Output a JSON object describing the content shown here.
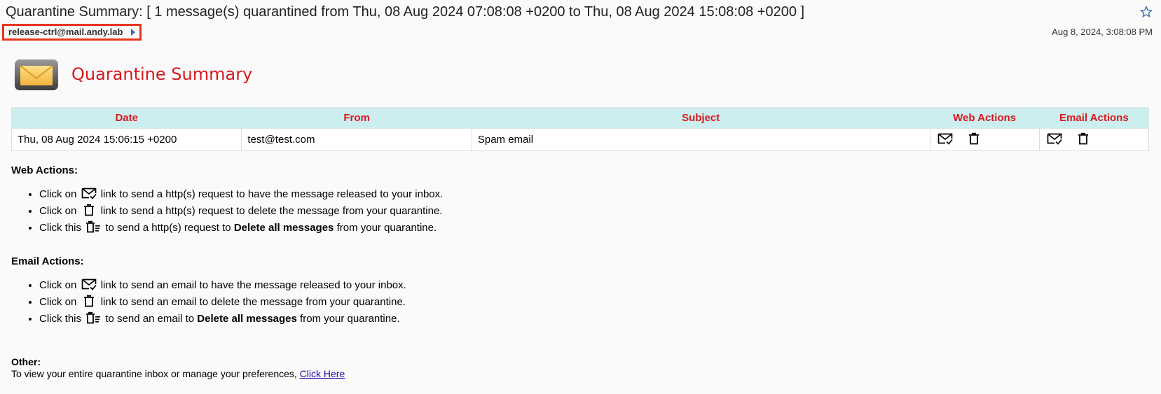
{
  "header": {
    "subject": "Quarantine Summary: [ 1 message(s) quarantined from Thu, 08 Aug 2024 07:08:08 +0200 to Thu, 08 Aug 2024 15:08:08 +0200 ]",
    "sender": "release-ctrl@mail.andy.lab",
    "date": "Aug 8, 2024, 3:08:08 PM",
    "icons": {
      "star": "star-icon",
      "expand": "chevron-right-icon"
    }
  },
  "summary": {
    "title": "Quarantine Summary",
    "logo_icon": "envelope-icon",
    "title_color": "#d9181e"
  },
  "table": {
    "headers": [
      "Date",
      "From",
      "Subject",
      "Web Actions",
      "Email Actions"
    ],
    "rows": [
      {
        "date": "Thu, 08 Aug 2024 15:06:15 +0200",
        "from": "test@test.com",
        "subject": "Spam email",
        "web_actions": [
          "release-mail-icon",
          "trash-icon"
        ],
        "email_actions": [
          "release-mail-icon",
          "trash-icon"
        ]
      }
    ],
    "header_bg": "#cdeeee",
    "header_color": "#d9181e"
  },
  "web_actions": {
    "heading": "Web Actions:",
    "items": [
      {
        "prefix": "Click on",
        "icon": "release-mail-icon",
        "text": "link to send a http(s) request to have the message released to your inbox."
      },
      {
        "prefix": "Click on",
        "icon": "trash-icon",
        "text": "link to send a http(s) request to delete the message from your quarantine."
      },
      {
        "prefix": "Click this",
        "icon": "delete-all-icon",
        "text_before": "to send a http(s) request to",
        "bold": "Delete all messages",
        "text_after": "from your quarantine."
      }
    ]
  },
  "email_actions": {
    "heading": "Email Actions:",
    "items": [
      {
        "prefix": "Click on",
        "icon": "release-mail-icon",
        "text": "link to send an email to have the message released to your inbox."
      },
      {
        "prefix": "Click on",
        "icon": "trash-icon",
        "text": "link to send an email to delete the message from your quarantine."
      },
      {
        "prefix": "Click this",
        "icon": "delete-all-icon",
        "text_before": "to send an email to",
        "bold": "Delete all messages",
        "text_after": "from your quarantine."
      }
    ]
  },
  "other": {
    "heading": "Other:",
    "text": "To view your entire quarantine inbox or manage your preferences,",
    "link": "Click Here"
  }
}
